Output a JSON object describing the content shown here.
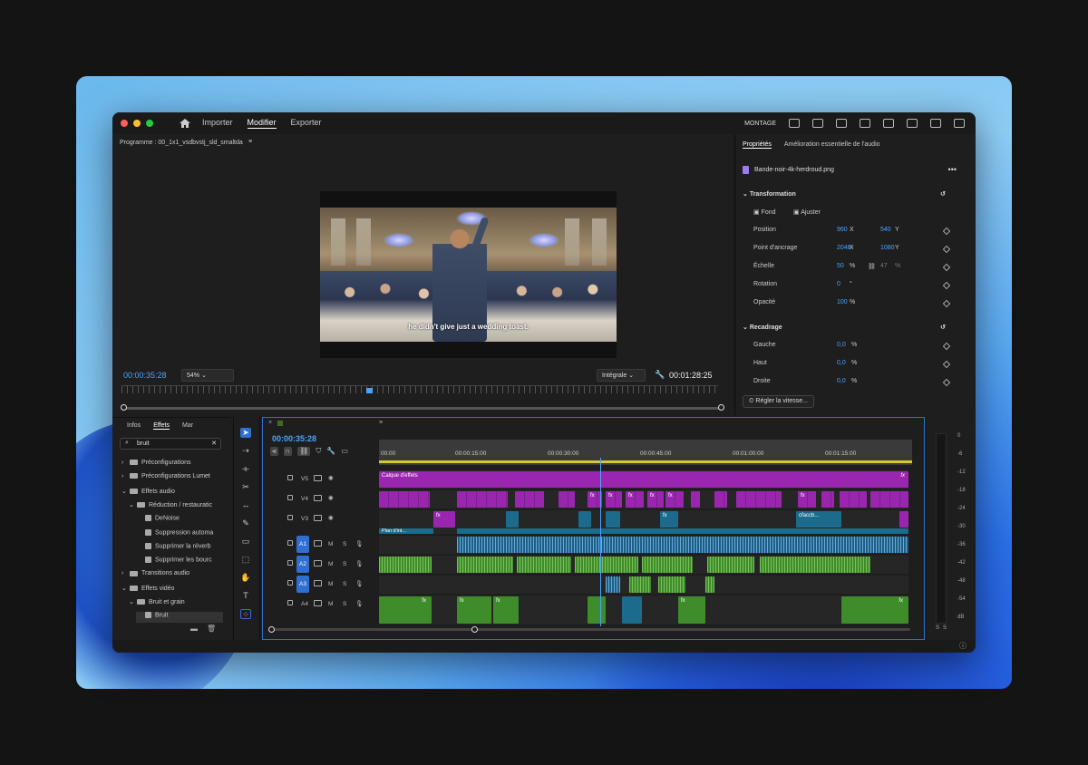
{
  "nav": {
    "importer": "Importer",
    "modifier": "Modifier",
    "exporter": "Exporter",
    "workspace": "MONTAGE"
  },
  "program": {
    "title": "Programme : 00_1x1_vsdbvstj_sld_smaltda",
    "subtitle_text": "he didn't give just a wedding toast.",
    "timecode_current": "00:00:35:28",
    "zoom": "54%",
    "quality": "Intégrale",
    "timecode_duration": "00:01:28:25",
    "scrub_position": 0.41
  },
  "properties": {
    "tab_active": "Propriétés",
    "tab_other": "Amélioration essentielle de l'audio",
    "clip_name": "Bande-noir-4k-herdroud.png",
    "transformation": "Transformation",
    "fond": "Fond",
    "ajuster": "Ajuster",
    "rows": [
      {
        "label": "Position",
        "v1": "960",
        "u1": "X",
        "v2": "540",
        "u2": "Y"
      },
      {
        "label": "Point d'ancrage",
        "v1": "2048",
        "u1": "X",
        "v2": "1080",
        "u2": "Y"
      },
      {
        "label": "Échelle",
        "v1": "50",
        "u1": "%",
        "v2": "47",
        "u2": "%"
      },
      {
        "label": "Rotation",
        "v1": "0",
        "u1": "°",
        "v2": "",
        "u2": ""
      },
      {
        "label": "Opacité",
        "v1": "100",
        "u1": "%",
        "v2": "",
        "u2": ""
      }
    ],
    "recadrage": "Recadrage",
    "crop_rows": [
      {
        "label": "Gauche",
        "v1": "0,0",
        "u1": "%"
      },
      {
        "label": "Haut",
        "v1": "0,0",
        "u1": "%"
      },
      {
        "label": "Droite",
        "v1": "0,0",
        "u1": "%"
      }
    ],
    "speed_button": "Régler la vitesse..."
  },
  "effects": {
    "tabs": [
      "Infos",
      "Effets",
      "Mar"
    ],
    "search_value": "bruit",
    "tree": [
      {
        "label": "Préconfigurations",
        "level": 0,
        "kind": "folder"
      },
      {
        "label": "Préconfigurations Lumet",
        "level": 0,
        "kind": "folder"
      },
      {
        "label": "Effets audio",
        "level": 0,
        "kind": "folder"
      },
      {
        "label": "Réduction / restauratic",
        "level": 1,
        "kind": "folder"
      },
      {
        "label": "DeNoise",
        "level": 2,
        "kind": "fx"
      },
      {
        "label": "Suppression automa",
        "level": 2,
        "kind": "fx"
      },
      {
        "label": "Supprimer la réverb",
        "level": 2,
        "kind": "fx"
      },
      {
        "label": "Supprimer les bourc",
        "level": 2,
        "kind": "fx"
      },
      {
        "label": "Transitions audio",
        "level": 0,
        "kind": "folder"
      },
      {
        "label": "Effets vidéo",
        "level": 0,
        "kind": "folder"
      },
      {
        "label": "Bruit et grain",
        "level": 1,
        "kind": "folder"
      },
      {
        "label": "Bruit",
        "level": 2,
        "kind": "fx"
      }
    ]
  },
  "timeline": {
    "timecode": "00:00:35:28",
    "ruler": [
      "00:00",
      "00:00:15:00",
      "00:00:30:00",
      "00:00:45:00",
      "00:01:00:00",
      "00:01:15:00"
    ],
    "tracks": [
      "V5",
      "V4",
      "V3",
      "A1",
      "A2",
      "A3",
      "A4"
    ],
    "clip_label_v5": "Calque d'effets",
    "clip_label_v3": "cfaccb...",
    "clip_label_v2": "Plan d'int...",
    "fx": "fx",
    "m": "M",
    "s": "S"
  },
  "meter": {
    "scale": [
      "0",
      "-6",
      "-12",
      "-18",
      "-24",
      "-30",
      "-36",
      "-42",
      "-48",
      "-54",
      "dB"
    ],
    "bottom": [
      "S",
      "S"
    ]
  },
  "colors": {
    "accent": "#4aa3ff",
    "adjust_layer": "#9a26b0",
    "video_clip": "#1c6b8c",
    "audio_clip": "#3e8d2a"
  }
}
